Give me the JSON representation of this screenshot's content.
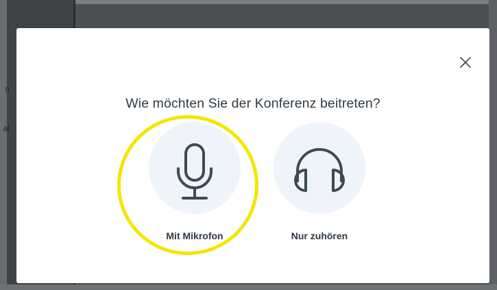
{
  "dialog": {
    "title": "Wie möchten Sie der Konferenz beitreten?",
    "close_icon": "close-icon",
    "options": [
      {
        "label": "Mit Mikrofon",
        "icon": "microphone-icon"
      },
      {
        "label": "Nur zuhören",
        "icon": "headphones-icon"
      }
    ]
  },
  "background": {
    "fragments": [
      "n",
      "al"
    ]
  },
  "colors": {
    "text": "#2f3a45",
    "icon_stroke": "#3c4a55",
    "option_bg": "#eef4fa",
    "highlight": "#f3e600",
    "overlay": "#4b4f53"
  }
}
